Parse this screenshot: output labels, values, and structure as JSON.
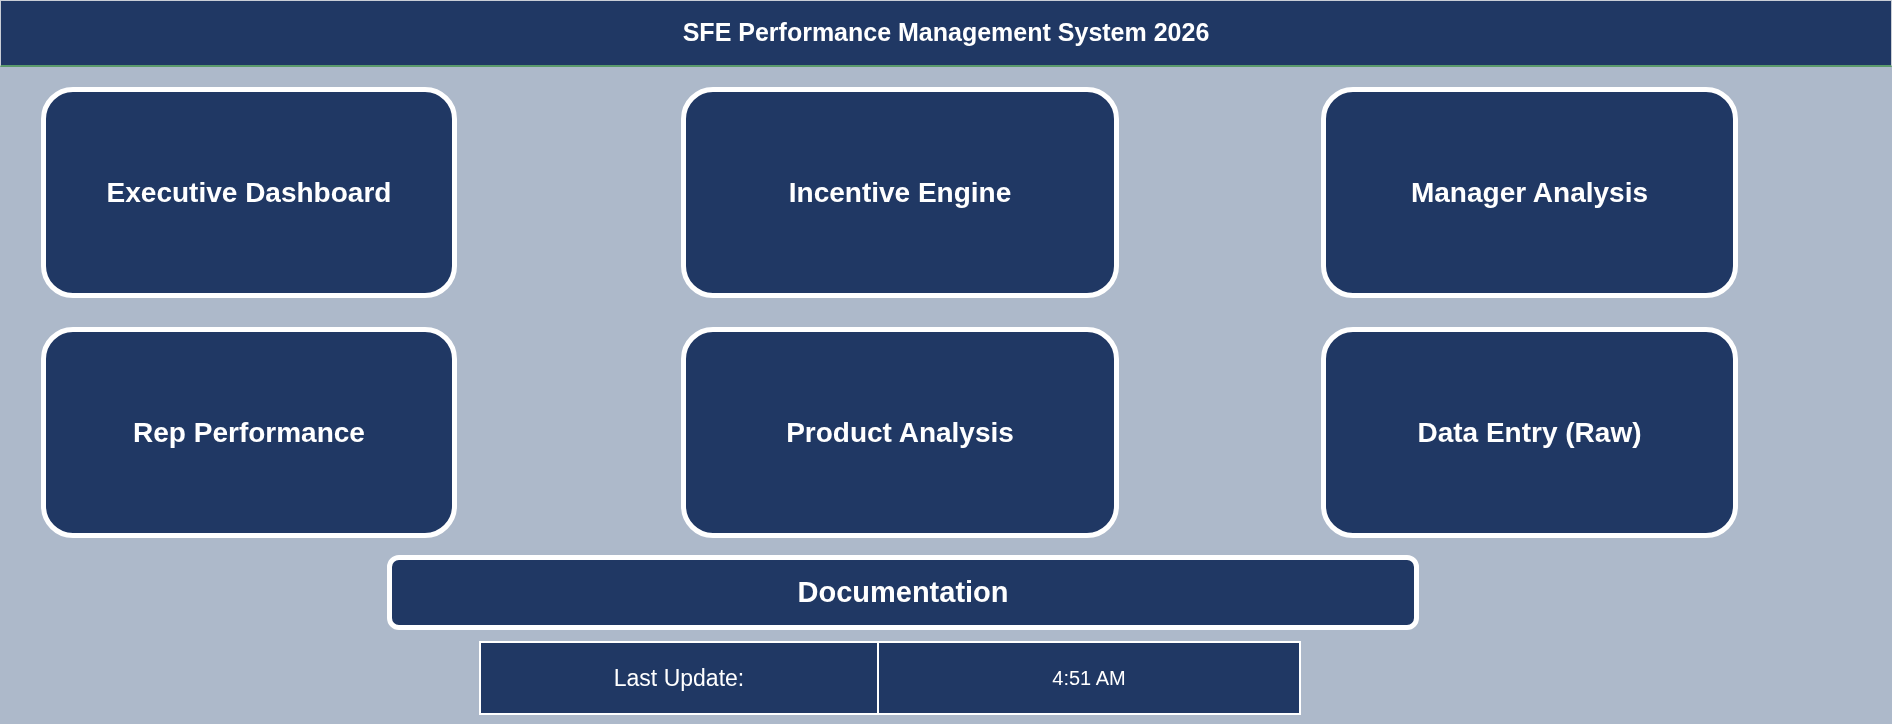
{
  "header": {
    "title": "SFE Performance Management System 2026"
  },
  "nav_buttons": [
    {
      "label": "Executive Dashboard"
    },
    {
      "label": "Incentive Engine"
    },
    {
      "label": "Manager Analysis"
    },
    {
      "label": "Rep Performance"
    },
    {
      "label": "Product Analysis"
    },
    {
      "label": "Data Entry (Raw)"
    }
  ],
  "documentation_button": {
    "label": "Documentation"
  },
  "last_update": {
    "label": "Last Update:",
    "value": "4:51 AM"
  }
}
